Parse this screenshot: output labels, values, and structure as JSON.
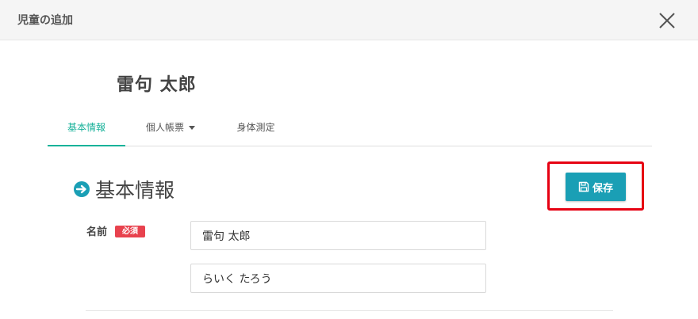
{
  "modal": {
    "title": "児童の追加",
    "close_icon": "close-x-icon"
  },
  "student": {
    "name": "雷句 太郎"
  },
  "tabs": [
    {
      "label": "基本情報",
      "active": true
    },
    {
      "label": "個人帳票",
      "active": false,
      "has_dropdown": true
    },
    {
      "label": "身体測定",
      "active": false
    }
  ],
  "section": {
    "title": "基本情報",
    "icon": "circle-arrow-right-icon"
  },
  "toolbar": {
    "save_label": "保存",
    "save_icon": "floppy-disk-icon"
  },
  "form": {
    "name_label": "名前",
    "required_badge": "必須",
    "name_value": "雷句 太郎",
    "kana_value": "らいく たろう"
  },
  "colors": {
    "accent": "#18b29a",
    "button": "#1a9fb5",
    "highlight": "#e60012",
    "badge": "#e8424e"
  }
}
